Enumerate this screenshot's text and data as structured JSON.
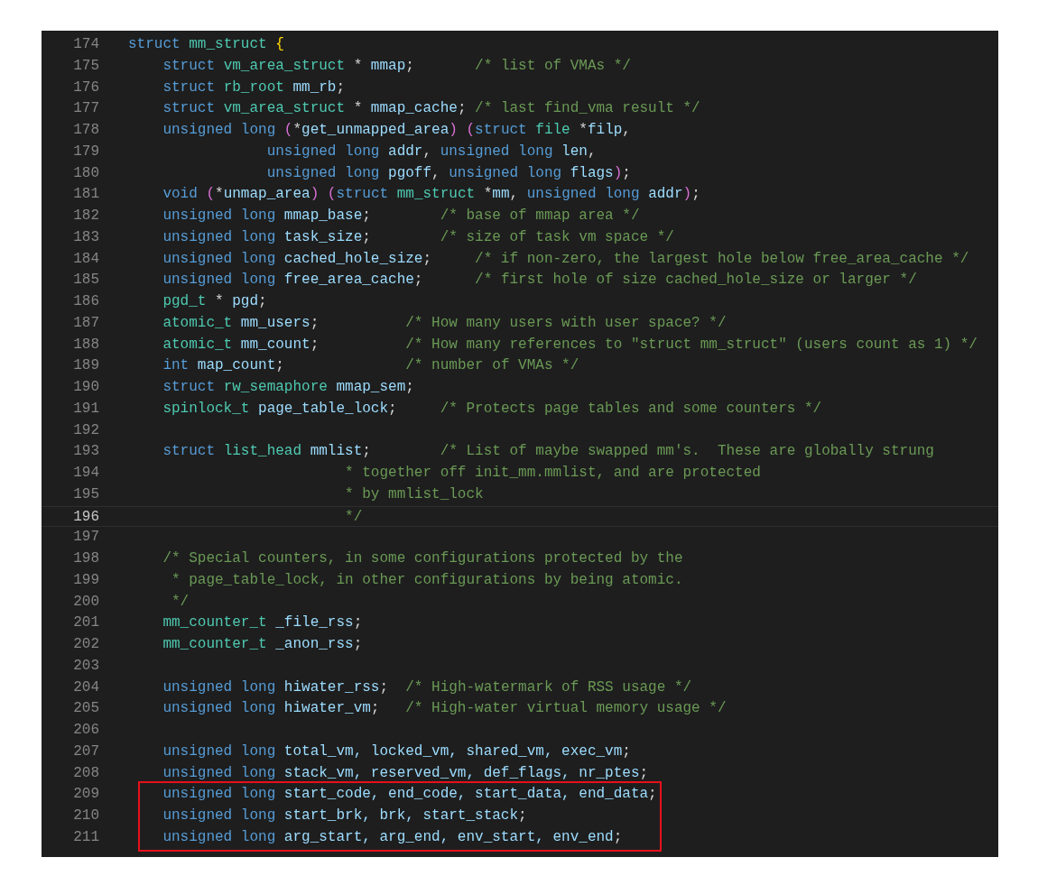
{
  "editor": {
    "lines": [
      {
        "number": "174",
        "tokens": [
          {
            "kind": "k",
            "text": "struct "
          },
          {
            "kind": "t",
            "text": "mm_struct "
          },
          {
            "kind": "b1",
            "text": "{"
          }
        ]
      },
      {
        "number": "175",
        "tokens": [
          {
            "kind": "k",
            "text": "    struct "
          },
          {
            "kind": "t",
            "text": "vm_area_struct "
          },
          {
            "kind": "p",
            "text": "* "
          },
          {
            "kind": "v",
            "text": "mmap"
          },
          {
            "kind": "p",
            "text": ";       "
          },
          {
            "kind": "c",
            "text": "/* list of VMAs */"
          }
        ]
      },
      {
        "number": "176",
        "tokens": [
          {
            "kind": "k",
            "text": "    struct "
          },
          {
            "kind": "t",
            "text": "rb_root "
          },
          {
            "kind": "v",
            "text": "mm_rb"
          },
          {
            "kind": "p",
            "text": ";"
          }
        ]
      },
      {
        "number": "177",
        "tokens": [
          {
            "kind": "k",
            "text": "    struct "
          },
          {
            "kind": "t",
            "text": "vm_area_struct "
          },
          {
            "kind": "p",
            "text": "* "
          },
          {
            "kind": "v",
            "text": "mmap_cache"
          },
          {
            "kind": "p",
            "text": "; "
          },
          {
            "kind": "c",
            "text": "/* last find_vma result */"
          }
        ]
      },
      {
        "number": "178",
        "tokens": [
          {
            "kind": "k",
            "text": "    unsigned long "
          },
          {
            "kind": "b2",
            "text": "("
          },
          {
            "kind": "p",
            "text": "*"
          },
          {
            "kind": "v",
            "text": "get_unmapped_area"
          },
          {
            "kind": "b2",
            "text": ") ("
          },
          {
            "kind": "k",
            "text": "struct "
          },
          {
            "kind": "t",
            "text": "file "
          },
          {
            "kind": "p",
            "text": "*"
          },
          {
            "kind": "v",
            "text": "filp"
          },
          {
            "kind": "p",
            "text": ","
          }
        ]
      },
      {
        "number": "179",
        "tokens": [
          {
            "kind": "k",
            "text": "                unsigned long "
          },
          {
            "kind": "v",
            "text": "addr"
          },
          {
            "kind": "p",
            "text": ", "
          },
          {
            "kind": "k",
            "text": "unsigned long "
          },
          {
            "kind": "v",
            "text": "len"
          },
          {
            "kind": "p",
            "text": ","
          }
        ]
      },
      {
        "number": "180",
        "tokens": [
          {
            "kind": "k",
            "text": "                unsigned long "
          },
          {
            "kind": "v",
            "text": "pgoff"
          },
          {
            "kind": "p",
            "text": ", "
          },
          {
            "kind": "k",
            "text": "unsigned long "
          },
          {
            "kind": "v",
            "text": "flags"
          },
          {
            "kind": "b2",
            "text": ")"
          },
          {
            "kind": "p",
            "text": ";"
          }
        ]
      },
      {
        "number": "181",
        "tokens": [
          {
            "kind": "k",
            "text": "    void "
          },
          {
            "kind": "b2",
            "text": "("
          },
          {
            "kind": "p",
            "text": "*"
          },
          {
            "kind": "v",
            "text": "unmap_area"
          },
          {
            "kind": "b2",
            "text": ") ("
          },
          {
            "kind": "k",
            "text": "struct "
          },
          {
            "kind": "t",
            "text": "mm_struct "
          },
          {
            "kind": "p",
            "text": "*"
          },
          {
            "kind": "v",
            "text": "mm"
          },
          {
            "kind": "p",
            "text": ", "
          },
          {
            "kind": "k",
            "text": "unsigned long "
          },
          {
            "kind": "v",
            "text": "addr"
          },
          {
            "kind": "b2",
            "text": ")"
          },
          {
            "kind": "p",
            "text": ";"
          }
        ]
      },
      {
        "number": "182",
        "tokens": [
          {
            "kind": "k",
            "text": "    unsigned long "
          },
          {
            "kind": "v",
            "text": "mmap_base"
          },
          {
            "kind": "p",
            "text": ";        "
          },
          {
            "kind": "c",
            "text": "/* base of mmap area */"
          }
        ]
      },
      {
        "number": "183",
        "tokens": [
          {
            "kind": "k",
            "text": "    unsigned long "
          },
          {
            "kind": "v",
            "text": "task_size"
          },
          {
            "kind": "p",
            "text": ";        "
          },
          {
            "kind": "c",
            "text": "/* size of task vm space */"
          }
        ]
      },
      {
        "number": "184",
        "tokens": [
          {
            "kind": "k",
            "text": "    unsigned long "
          },
          {
            "kind": "v",
            "text": "cached_hole_size"
          },
          {
            "kind": "p",
            "text": ";     "
          },
          {
            "kind": "c",
            "text": "/* if non-zero, the largest hole below free_area_cache */"
          }
        ]
      },
      {
        "number": "185",
        "tokens": [
          {
            "kind": "k",
            "text": "    unsigned long "
          },
          {
            "kind": "v",
            "text": "free_area_cache"
          },
          {
            "kind": "p",
            "text": ";      "
          },
          {
            "kind": "c",
            "text": "/* first hole of size cached_hole_size or larger */"
          }
        ]
      },
      {
        "number": "186",
        "tokens": [
          {
            "kind": "t",
            "text": "    pgd_t "
          },
          {
            "kind": "p",
            "text": "* "
          },
          {
            "kind": "v",
            "text": "pgd"
          },
          {
            "kind": "p",
            "text": ";"
          }
        ]
      },
      {
        "number": "187",
        "tokens": [
          {
            "kind": "t",
            "text": "    atomic_t "
          },
          {
            "kind": "v",
            "text": "mm_users"
          },
          {
            "kind": "p",
            "text": ";          "
          },
          {
            "kind": "c",
            "text": "/* How many users with user space? */"
          }
        ]
      },
      {
        "number": "188",
        "tokens": [
          {
            "kind": "t",
            "text": "    atomic_t "
          },
          {
            "kind": "v",
            "text": "mm_count"
          },
          {
            "kind": "p",
            "text": ";          "
          },
          {
            "kind": "c",
            "text": "/* How many references to \"struct mm_struct\" (users count as 1) */"
          }
        ]
      },
      {
        "number": "189",
        "tokens": [
          {
            "kind": "k",
            "text": "    int "
          },
          {
            "kind": "v",
            "text": "map_count"
          },
          {
            "kind": "p",
            "text": ";              "
          },
          {
            "kind": "c",
            "text": "/* number of VMAs */"
          }
        ]
      },
      {
        "number": "190",
        "tokens": [
          {
            "kind": "k",
            "text": "    struct "
          },
          {
            "kind": "t",
            "text": "rw_semaphore "
          },
          {
            "kind": "v",
            "text": "mmap_sem"
          },
          {
            "kind": "p",
            "text": ";"
          }
        ]
      },
      {
        "number": "191",
        "tokens": [
          {
            "kind": "t",
            "text": "    spinlock_t "
          },
          {
            "kind": "v",
            "text": "page_table_lock"
          },
          {
            "kind": "p",
            "text": ";     "
          },
          {
            "kind": "c",
            "text": "/* Protects page tables and some counters */"
          }
        ]
      },
      {
        "number": "192"
      },
      {
        "number": "193",
        "tokens": [
          {
            "kind": "k",
            "text": "    struct "
          },
          {
            "kind": "t",
            "text": "list_head "
          },
          {
            "kind": "v",
            "text": "mmlist"
          },
          {
            "kind": "p",
            "text": ";        "
          },
          {
            "kind": "c",
            "text": "/* List of maybe swapped mm's.  These are globally strung"
          }
        ]
      },
      {
        "number": "194",
        "tokens": [
          {
            "kind": "c",
            "text": "                         * together off init_mm.mmlist, and are protected"
          }
        ]
      },
      {
        "number": "195",
        "tokens": [
          {
            "kind": "c",
            "text": "                         * by mmlist_lock"
          }
        ]
      },
      {
        "number": "196",
        "current": true,
        "tokens": [
          {
            "kind": "c",
            "text": "                         */"
          }
        ]
      },
      {
        "number": "197"
      },
      {
        "number": "198",
        "tokens": [
          {
            "kind": "c",
            "text": "    /* Special counters, in some configurations protected by the"
          }
        ]
      },
      {
        "number": "199",
        "tokens": [
          {
            "kind": "c",
            "text": "     * page_table_lock, in other configurations by being atomic."
          }
        ]
      },
      {
        "number": "200",
        "tokens": [
          {
            "kind": "c",
            "text": "     */"
          }
        ]
      },
      {
        "number": "201",
        "tokens": [
          {
            "kind": "t",
            "text": "    mm_counter_t "
          },
          {
            "kind": "v",
            "text": "_file_rss"
          },
          {
            "kind": "p",
            "text": ";"
          }
        ]
      },
      {
        "number": "202",
        "tokens": [
          {
            "kind": "t",
            "text": "    mm_counter_t "
          },
          {
            "kind": "v",
            "text": "_anon_rss"
          },
          {
            "kind": "p",
            "text": ";"
          }
        ]
      },
      {
        "number": "203"
      },
      {
        "number": "204",
        "tokens": [
          {
            "kind": "k",
            "text": "    unsigned long "
          },
          {
            "kind": "v",
            "text": "hiwater_rss"
          },
          {
            "kind": "p",
            "text": ";  "
          },
          {
            "kind": "c",
            "text": "/* High-watermark of RSS usage */"
          }
        ]
      },
      {
        "number": "205",
        "tokens": [
          {
            "kind": "k",
            "text": "    unsigned long "
          },
          {
            "kind": "v",
            "text": "hiwater_vm"
          },
          {
            "kind": "p",
            "text": ";   "
          },
          {
            "kind": "c",
            "text": "/* High-water virtual memory usage */"
          }
        ]
      },
      {
        "number": "206"
      },
      {
        "number": "207",
        "tokens": [
          {
            "kind": "k",
            "text": "    unsigned long "
          },
          {
            "kind": "v",
            "text": "total_vm, locked_vm, shared_vm, exec_vm"
          },
          {
            "kind": "p",
            "text": ";"
          }
        ]
      },
      {
        "number": "208",
        "tokens": [
          {
            "kind": "k",
            "text": "    unsigned long "
          },
          {
            "kind": "v",
            "text": "stack_vm, reserved_vm, def_flags, nr_ptes"
          },
          {
            "kind": "p",
            "text": ";"
          }
        ]
      },
      {
        "number": "209",
        "highlighted": true,
        "tokens": [
          {
            "kind": "k",
            "text": "    unsigned long "
          },
          {
            "kind": "v",
            "text": "start_code, end_code, start_data, end_data"
          },
          {
            "kind": "p",
            "text": ";"
          }
        ]
      },
      {
        "number": "210",
        "highlighted": true,
        "tokens": [
          {
            "kind": "k",
            "text": "    unsigned long "
          },
          {
            "kind": "v",
            "text": "start_brk, brk, start_stack"
          },
          {
            "kind": "p",
            "text": ";"
          }
        ]
      },
      {
        "number": "211",
        "highlighted": true,
        "tokens": [
          {
            "kind": "k",
            "text": "    unsigned long "
          },
          {
            "kind": "v",
            "text": "arg_start, arg_end, env_start, env_end"
          },
          {
            "kind": "p",
            "text": ";"
          }
        ]
      }
    ]
  }
}
